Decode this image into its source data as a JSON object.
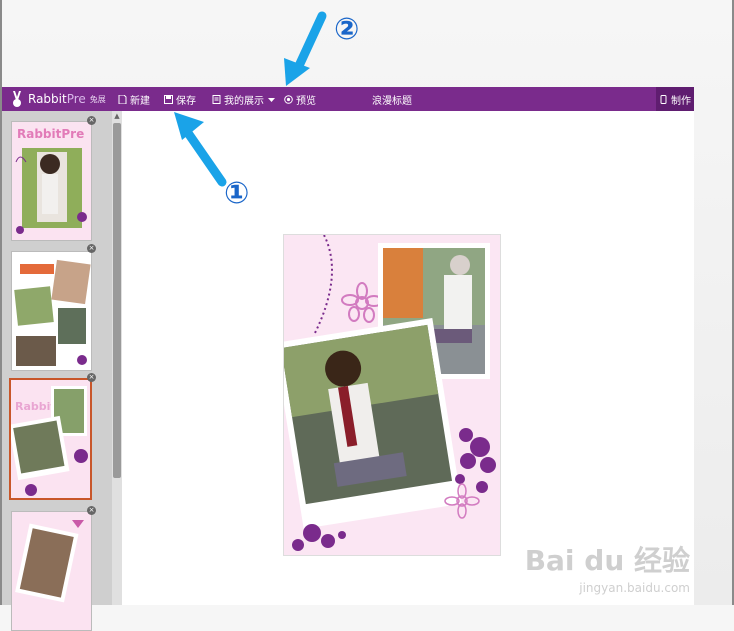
{
  "toolbar": {
    "logo_text": "Rabbit",
    "logo_text_pre": "Pre",
    "logo_sub": "兔展",
    "new_label": "新建",
    "save_label": "保存",
    "myshow_label": "我的展示",
    "preview_label": "预览",
    "page_title": "浪漫标题",
    "make_label": "制作"
  },
  "sidebar": {
    "thumbs": [
      {
        "title": "RabbitPre",
        "selected": false
      },
      {
        "title": "",
        "selected": false
      },
      {
        "title": "Rabbit",
        "selected": true
      },
      {
        "title": "",
        "selected": false
      }
    ],
    "delete_glyph": "×"
  },
  "annotations": {
    "step1": "①",
    "step2": "②",
    "arrow_color": "#1aa3e8"
  },
  "watermark": {
    "main": "Bai du 经验",
    "sub": "jingyan.baidu.com"
  },
  "colors": {
    "toolbar_bg": "#7a2b8c",
    "make_bg": "#5f1d70",
    "selected_border": "#c8562a",
    "canvas_bg": "#fbe6f3",
    "flower": "#7a2b8c"
  }
}
